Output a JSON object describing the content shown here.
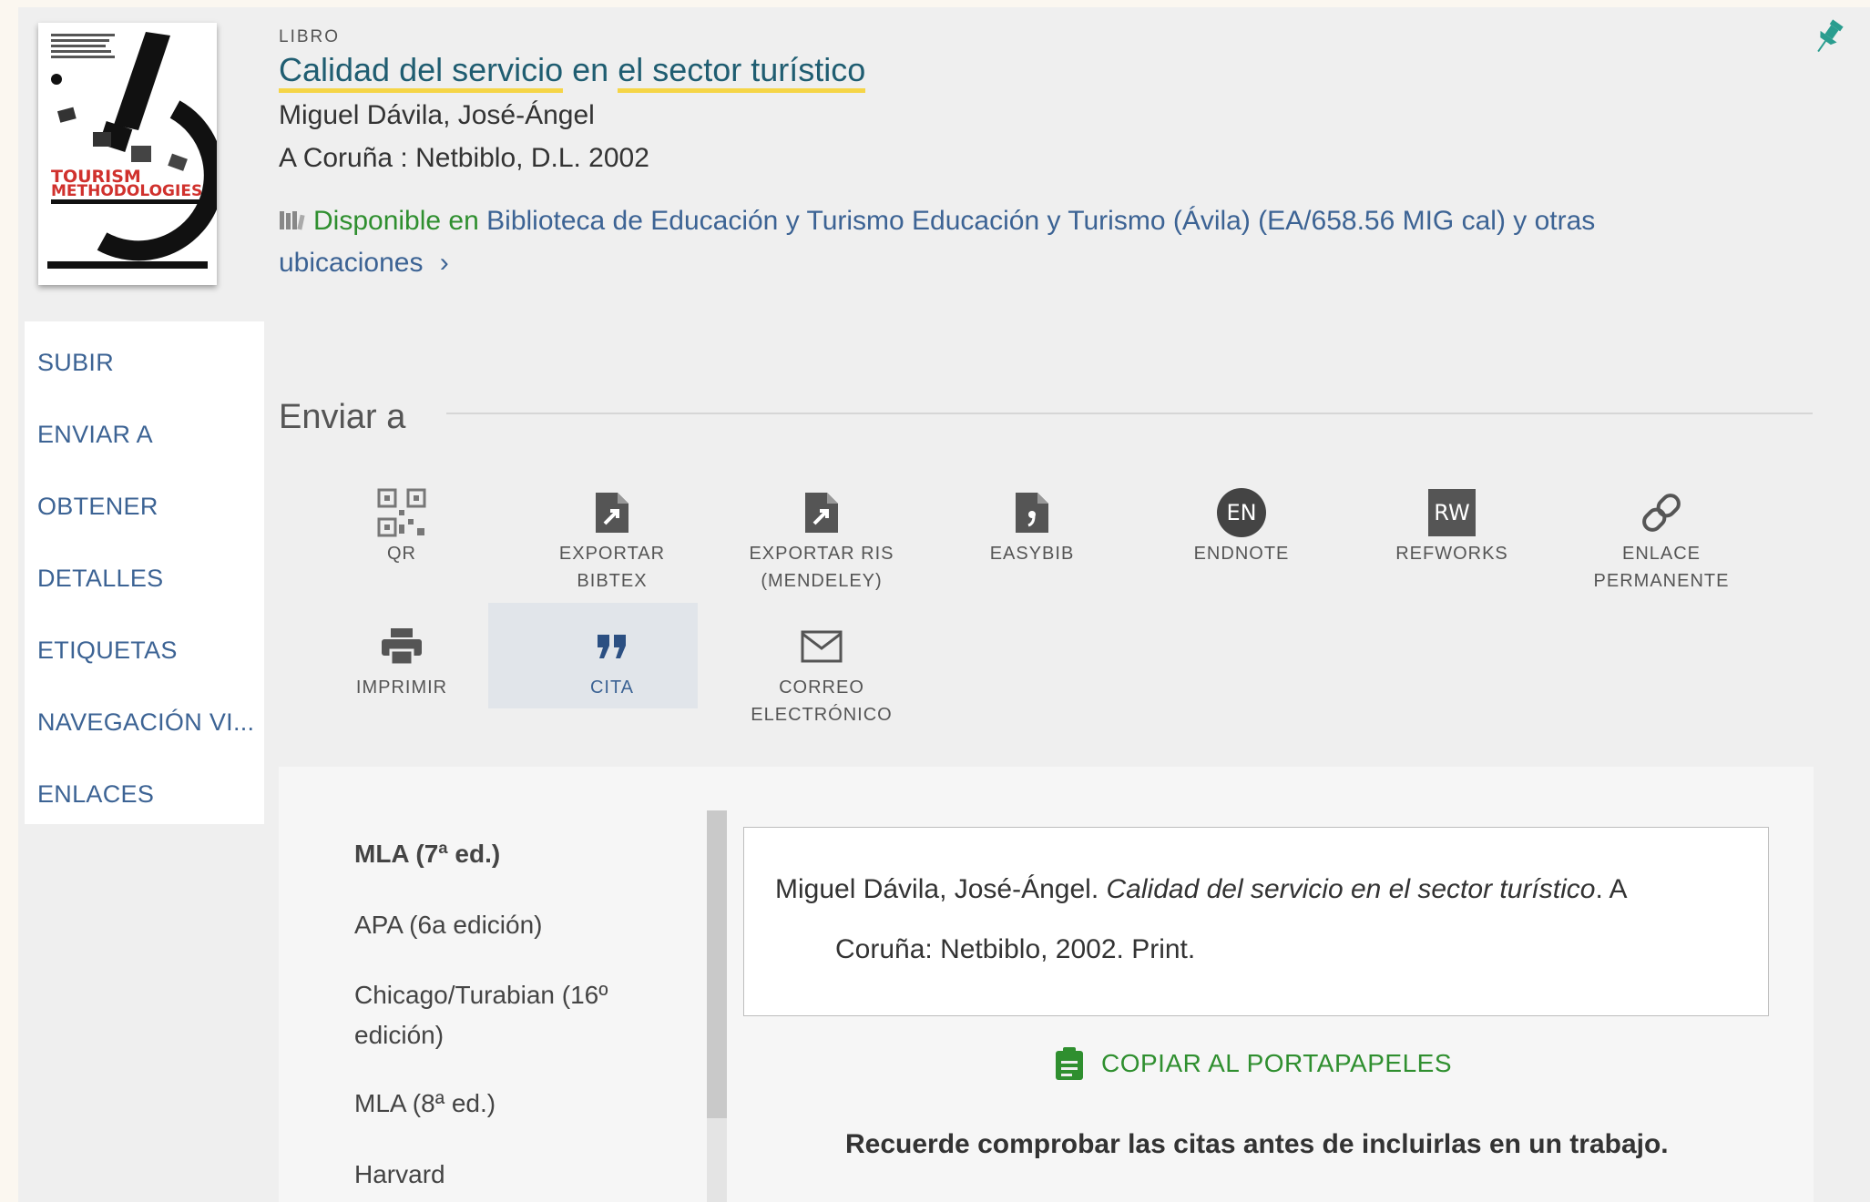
{
  "record": {
    "type": "LIBRO",
    "title_part1": "Calidad del servicio",
    "title_mid": " en ",
    "title_part2": "el sector turístico",
    "author": "Miguel Dávila, José-Ángel",
    "publication": "A Coruña : Netbiblo, D.L. 2002",
    "availability": {
      "status": "Disponible en",
      "location": "Biblioteca de Educación y Turismo  Educación y Turismo (Ávila) (EA/658.56 MIG cal) y otras ubicaciones",
      "chevron": "›"
    },
    "cover": {
      "title_line1": "TOURISM",
      "title_line2": "METHODOLOGIES"
    }
  },
  "nav": {
    "items": [
      {
        "label": "SUBIR"
      },
      {
        "label": "ENVIAR A"
      },
      {
        "label": "OBTENER"
      },
      {
        "label": "DETALLES"
      },
      {
        "label": "ETIQUETAS"
      },
      {
        "label": "NAVEGACIÓN VI..."
      },
      {
        "label": "ENLACES"
      }
    ]
  },
  "send_to": {
    "heading": "Enviar a",
    "actions": [
      {
        "label_line1": "QR",
        "label_line2": "",
        "icon": "qr-icon"
      },
      {
        "label_line1": "EXPORTAR",
        "label_line2": "BIBTEX",
        "icon": "file-export-icon"
      },
      {
        "label_line1": "EXPORTAR RIS",
        "label_line2": "(MENDELEY)",
        "icon": "file-export-icon"
      },
      {
        "label_line1": "EASYBIB",
        "label_line2": "",
        "icon": "file-easybib-icon"
      },
      {
        "label_line1": "ENDNOTE",
        "label_line2": "",
        "icon": "endnote-icon",
        "badge": "EN"
      },
      {
        "label_line1": "REFWORKS",
        "label_line2": "",
        "icon": "refworks-icon",
        "badge": "RW"
      },
      {
        "label_line1": "ENLACE",
        "label_line2": "PERMANENTE",
        "icon": "link-icon"
      },
      {
        "label_line1": "IMPRIMIR",
        "label_line2": "",
        "icon": "printer-icon"
      },
      {
        "label_line1": "CITA",
        "label_line2": "",
        "icon": "quote-icon"
      },
      {
        "label_line1": "CORREO",
        "label_line2": "ELECTRÓNICO",
        "icon": "envelope-icon"
      }
    ]
  },
  "citation": {
    "styles": [
      {
        "label": "MLA (7ª ed.)"
      },
      {
        "label": "APA (6a edición)"
      },
      {
        "label": "Chicago/Turabian (16º edición)"
      },
      {
        "label": "MLA (8ª ed.)"
      },
      {
        "label": "Harvard"
      }
    ],
    "text_author": "Miguel Dávila, José-Ángel. ",
    "text_title": "Calidad del servicio en el sector turístico",
    "text_rest1": ". A",
    "text_line2": "Coruña: Netbiblo, 2002. Print.",
    "copy_label": "COPIAR AL PORTAPAPELES",
    "note": "Recuerde comprobar las citas antes de incluirlas en un trabajo."
  },
  "colors": {
    "link": "#3c6394",
    "title": "#1f5d71",
    "available": "#2f8f2f",
    "highlight": "#f5d547",
    "pin": "#2a9d8f"
  }
}
